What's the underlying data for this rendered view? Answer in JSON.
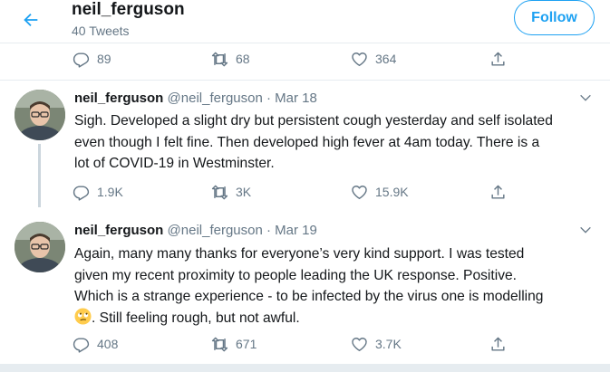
{
  "header": {
    "title": "neil_ferguson",
    "subtitle": "40 Tweets",
    "follow_label": "Follow"
  },
  "prev_tweet": {
    "replies": "89",
    "retweets": "68",
    "likes": "364"
  },
  "tweets": [
    {
      "name": "neil_ferguson",
      "handle": "@neil_ferguson",
      "separator": "·",
      "date": "Mar 18",
      "lines": [
        "Sigh. Developed a slight dry but persistent cough yesterday and self isolated",
        "even though I felt fine. Then developed high fever at 4am today. There is a",
        "lot of COVID-19 in Westminster."
      ],
      "replies": "1.9K",
      "retweets": "3K",
      "likes": "15.9K"
    },
    {
      "name": "neil_ferguson",
      "handle": "@neil_ferguson",
      "separator": "·",
      "date": "Mar 19",
      "lines": [
        "Again, many many thanks for everyone’s very kind support. I was tested",
        "given my recent proximity to people leading the UK response. Positive.",
        "Which is a strange experience - to be infected by the virus one is modelling",
        ". Still feeling rough, but not awful."
      ],
      "emoji": "face-with-rolling-eyes",
      "replies": "408",
      "retweets": "671",
      "likes": "3.7K"
    }
  ],
  "colors": {
    "accent": "#1da1f2",
    "secondary_text": "#657786",
    "border": "#e6ecf0"
  },
  "icons": [
    "back-arrow-icon",
    "reply-icon",
    "retweet-icon",
    "like-icon",
    "share-icon",
    "chevron-down-icon"
  ]
}
